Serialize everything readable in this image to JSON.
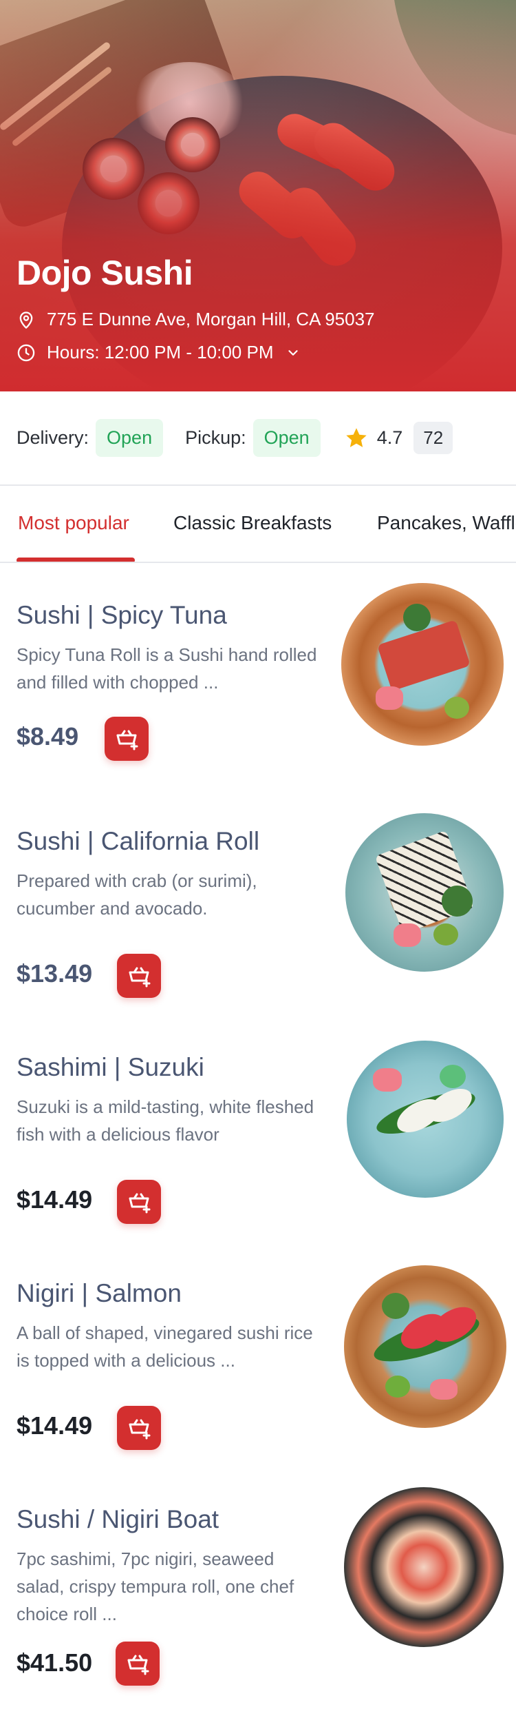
{
  "restaurant": {
    "name": "Dojo Sushi",
    "address": "775 E Dunne Ave, Morgan Hill, CA 95037",
    "hours": "Hours: 12:00 PM - 10:00 PM"
  },
  "status": {
    "delivery_label": "Delivery:",
    "delivery_value": "Open",
    "pickup_label": "Pickup:",
    "pickup_value": "Open",
    "rating": "4.7",
    "review_count": "72"
  },
  "tabs": [
    {
      "label": "Most popular",
      "active": true
    },
    {
      "label": "Classic Breakfasts",
      "active": false
    },
    {
      "label": "Pancakes, Waffles",
      "active": false
    }
  ],
  "menu": [
    {
      "name": "Sushi | Spicy Tuna",
      "description": "Spicy Tuna Roll is a Sushi hand rolled and filled with chopped ...",
      "price": "$8.49"
    },
    {
      "name": "Sushi | California Roll",
      "description": "Prepared with crab (or surimi), cucumber and avocado.",
      "price": "$13.49"
    },
    {
      "name": "Sashimi | Suzuki",
      "description": "Suzuki is a mild-tasting, white fleshed fish with a delicious flavor",
      "price": "$14.49"
    },
    {
      "name": "Nigiri | Salmon",
      "description": "A ball of shaped, vinegared sushi rice is topped with a delicious ...",
      "price": "$14.49"
    },
    {
      "name": "Sushi / Nigiri Boat",
      "description": "7pc sashimi, 7pc nigiri, seaweed salad, crispy tempura roll, one chef choice roll ...",
      "price": "$41.50"
    }
  ],
  "colors": {
    "accent": "#d32f2f",
    "open_text": "#21a356",
    "open_bg": "#e8f9ed",
    "star": "#f6b10a",
    "title_text": "#4a5672"
  },
  "icons": [
    "location-pin-icon",
    "clock-icon",
    "chevron-down-icon",
    "star-icon",
    "add-to-basket-icon"
  ]
}
